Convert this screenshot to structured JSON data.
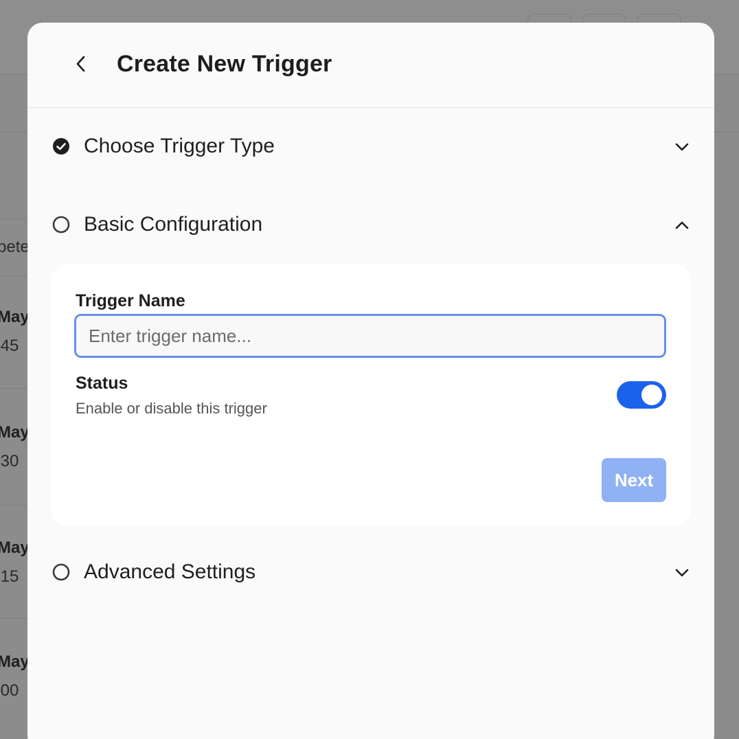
{
  "background": {
    "column_header": "pete",
    "rows": [
      {
        "date": "May",
        "time": ":45"
      },
      {
        "date": "May",
        "time": ":30"
      },
      {
        "date": "May",
        "time": ":15"
      },
      {
        "date": "May",
        "time": ":00"
      }
    ]
  },
  "modal": {
    "title": "Create New Trigger",
    "back_icon": "chevron-left-icon",
    "sections": [
      {
        "label": "Choose Trigger Type",
        "status": "completed",
        "expanded": false
      },
      {
        "label": "Basic Configuration",
        "status": "pending",
        "expanded": true
      },
      {
        "label": "Advanced Settings",
        "status": "pending",
        "expanded": false
      }
    ],
    "basic_config": {
      "name_label": "Trigger Name",
      "name_value": "",
      "name_placeholder": "Enter trigger name...",
      "status_label": "Status",
      "status_description": "Enable or disable this trigger",
      "status_enabled": true,
      "next_label": "Next"
    }
  },
  "colors": {
    "accent": "#1c63eb",
    "next_disabled": "#90b1f4",
    "input_focus_border": "#6b8fe6",
    "overlay": "#8c8c8c"
  }
}
